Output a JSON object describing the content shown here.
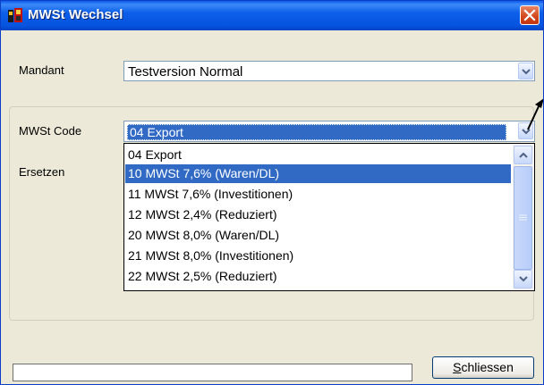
{
  "window": {
    "title": "MWSt Wechsel"
  },
  "mandant": {
    "label": "Mandant",
    "value": "Testversion Normal"
  },
  "mwst_code": {
    "label": "MWSt Code",
    "value": "04 Export",
    "options": [
      "04 Export",
      "10 MWSt 7,6% (Waren/DL)",
      "11 MWSt 7,6% (Investitionen)",
      "12 MWSt 2,4% (Reduziert)",
      "20 MWSt 8,0% (Waren/DL)",
      "21 MWSt 8,0% (Investitionen)",
      "22 MWSt 2,5% (Reduziert)"
    ],
    "highlighted_option": "10 MWSt 7,6% (Waren/DL)"
  },
  "ersetzen": {
    "label": "Ersetzen"
  },
  "close_button": {
    "mnemonic": "S",
    "label_rest": "chliessen"
  },
  "colors": {
    "titlebar": "#0553df",
    "selection": "#316ac5",
    "window_bg": "#ece9d8",
    "close": "#d1461c"
  },
  "icons": {
    "app": "app-icon",
    "close": "close-icon",
    "dropdown": "chevron-down-icon",
    "scroll_up": "arrow-up-icon",
    "scroll_down": "arrow-down-icon",
    "pointer": "arrow-pointer-icon"
  }
}
